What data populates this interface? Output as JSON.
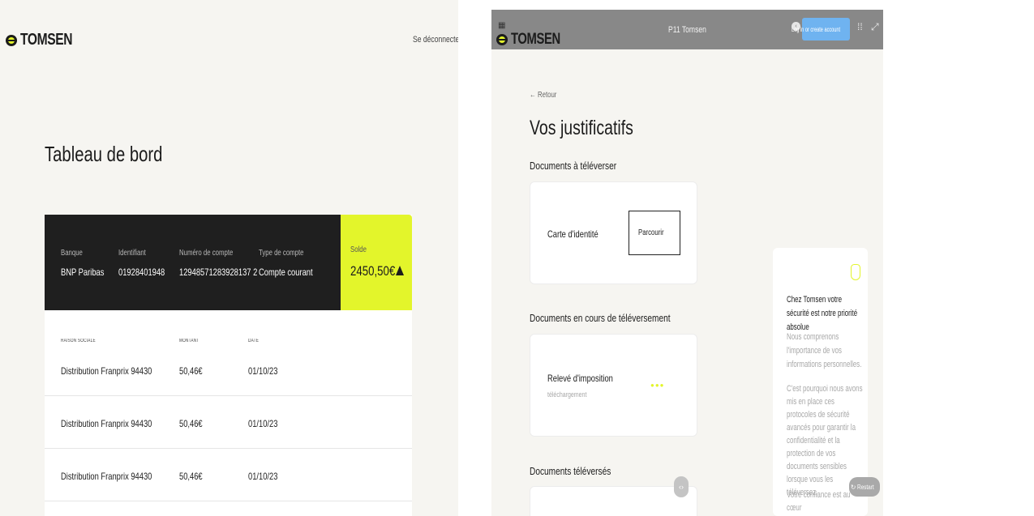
{
  "left": {
    "brand": "TOMSEN",
    "logout": "Se déconnecter",
    "title": "Tableau de bord",
    "account": {
      "bank_label": "Banque",
      "bank_value": "BNP Paribas",
      "id_label": "Identifiant",
      "id_value": "01928401948",
      "number_label": "Numéro de compte",
      "number_value": "12948571283928137 2",
      "type_label": "Type de compte",
      "type_value": "Compte courant",
      "balance_label": "Solde",
      "balance_value": "2450,50€"
    },
    "table": {
      "headers": [
        "RAISON SOCIALE",
        "MONTANT",
        "DATE"
      ],
      "rows": [
        [
          "Distribution Franprix 94430",
          "50,46€",
          "01/10/23"
        ],
        [
          "Distribution Franprix 94430",
          "50,46€",
          "01/10/23"
        ],
        [
          "Distribution Franprix 94430",
          "50,46€",
          "01/10/23"
        ]
      ]
    }
  },
  "right": {
    "brand": "TOMSEN",
    "window_title": "P11 Tomsen",
    "login_button": "Log in or create account",
    "back": "← Retour",
    "title": "Vos justificatifs",
    "section_upload": "Documents à téléverser",
    "id_card": "Carte d'identité",
    "browse": "Parcourir",
    "section_uploading": "Documents en cours de téléversement",
    "tax_notice": "Relevé d'imposition",
    "tax_status": "téléchargement",
    "section_uploaded": "Documents téléversés",
    "security_title": "Chez Tomsen votre sécurité est notre priorité absolue",
    "security_p1": "Nous comprenons l'importance de vos informations personnelles.",
    "security_p2": "C'est pourquoi nous avons mis en place ces protocoles de sécurité avancés pour garantir la confidentialité et la protection de vos documents sensibles lorsque vous les téléversez.",
    "security_p3": "Votre confiance est au cœur",
    "restart": "Restart"
  },
  "colors": {
    "lime": "#e3f52b",
    "dark": "#1f1f1f",
    "bg": "#f6f5f1",
    "bar": "#888888",
    "blue": "#6fb3f0"
  }
}
